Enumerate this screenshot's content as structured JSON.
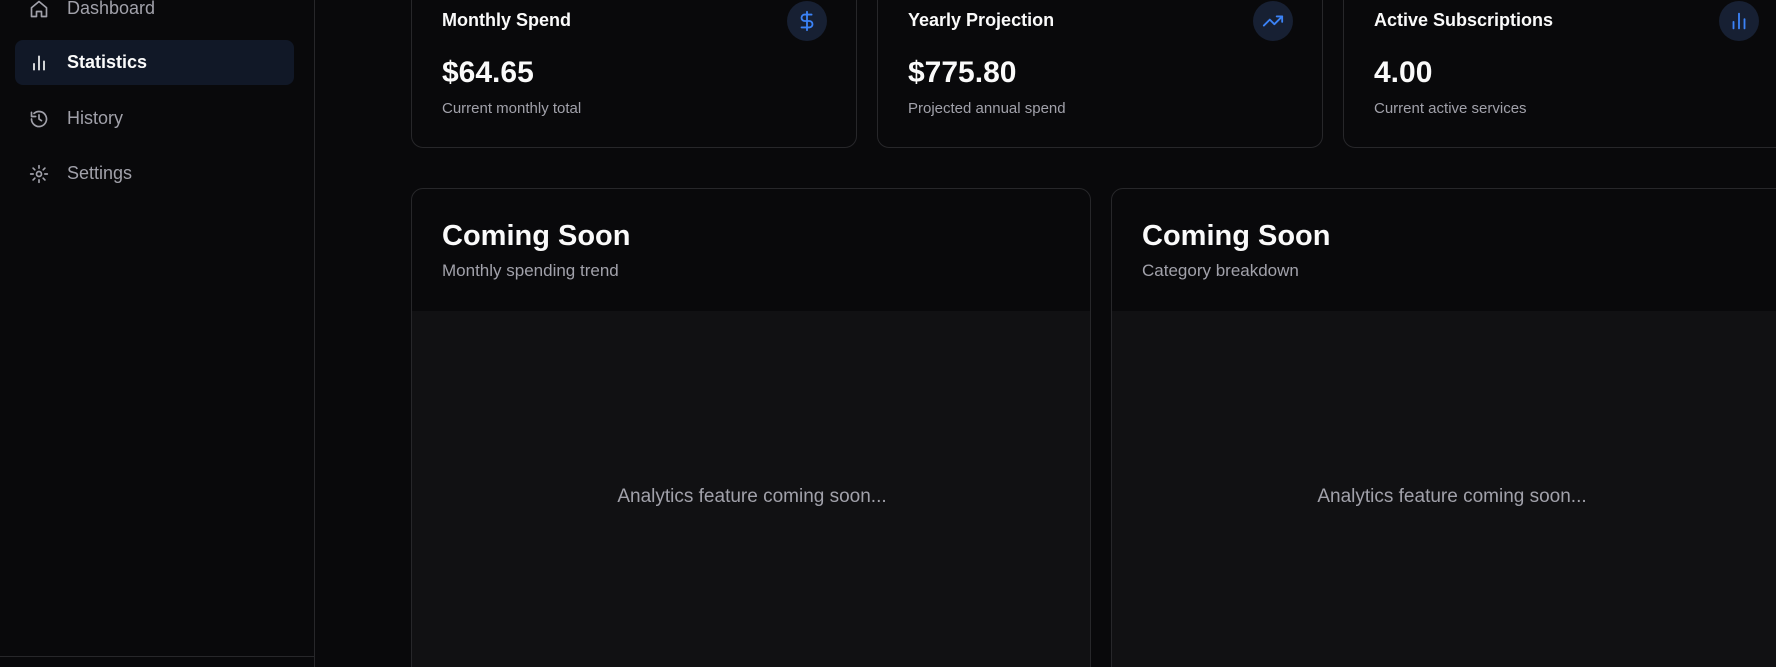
{
  "sidebar": {
    "items": [
      {
        "label": "Dashboard",
        "icon": "home-icon",
        "active": false
      },
      {
        "label": "Statistics",
        "icon": "bar-chart-icon",
        "active": true
      },
      {
        "label": "History",
        "icon": "history-icon",
        "active": false
      },
      {
        "label": "Settings",
        "icon": "gear-icon",
        "active": false
      }
    ]
  },
  "stats": [
    {
      "title": "Monthly Spend",
      "value": "$64.65",
      "subtitle": "Current monthly total",
      "icon": "dollar-icon"
    },
    {
      "title": "Yearly Projection",
      "value": "$775.80",
      "subtitle": "Projected annual spend",
      "icon": "trending-up-icon"
    },
    {
      "title": "Active Subscriptions",
      "value": "4.00",
      "subtitle": "Current active services",
      "icon": "bar-chart-icon"
    }
  ],
  "panels": [
    {
      "title": "Coming Soon",
      "subtitle": "Monthly spending trend",
      "placeholder": "Analytics feature coming soon..."
    },
    {
      "title": "Coming Soon",
      "subtitle": "Category breakdown",
      "placeholder": "Analytics feature coming soon..."
    }
  ],
  "colors": {
    "background": "#09090b",
    "accent": "#3b82f6",
    "active_nav": "#111827",
    "border": "#27272a",
    "muted_text": "#a1a1aa"
  }
}
